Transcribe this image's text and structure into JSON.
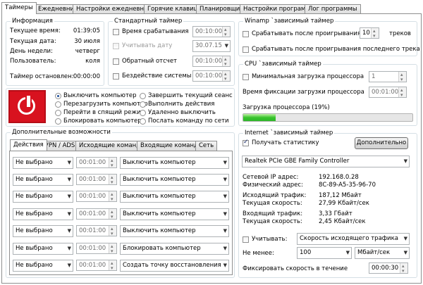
{
  "tabs": [
    {
      "label": "Таймеры",
      "active": true
    },
    {
      "label": "Ежедневник"
    },
    {
      "label": "Настройки ежедневника"
    },
    {
      "label": "Горячие клавиши"
    },
    {
      "label": "Планировщик"
    },
    {
      "label": "Настройки программы"
    },
    {
      "label": "Лог программы"
    }
  ],
  "info": {
    "title": "Информация",
    "rows": [
      {
        "label": "Текущее время:",
        "value": "01:39:05"
      },
      {
        "label": "Текущая дата:",
        "value": "30 июля"
      },
      {
        "label": "День недели:",
        "value": "четверг"
      },
      {
        "label": "Пользователь:",
        "value": "коля"
      }
    ],
    "timer_label": "Таймер остановлен:",
    "timer_value": "00:00:00"
  },
  "std_timer": {
    "title": "Стандартный таймер",
    "rows": [
      {
        "label": "Время срабатывания",
        "value": "00:10:00",
        "disabled": false
      },
      {
        "label": "Учитывать дату",
        "value": "30.07.15",
        "disabled": true
      },
      {
        "label": "Обратный отсчет",
        "value": "00:10:00",
        "disabled": false
      },
      {
        "label": "Бездействие системы",
        "value": "00:10:00",
        "disabled": false
      }
    ]
  },
  "actions": {
    "left": [
      {
        "label": "Выключить компьютер",
        "checked": true
      },
      {
        "label": "Перезагрузить компьютер"
      },
      {
        "label": "Перейти в спящий режим"
      },
      {
        "label": "Блокировать компьютер"
      }
    ],
    "right": [
      {
        "label": "Завершить текущий сеанс"
      },
      {
        "label": "Выполнить действия"
      },
      {
        "label": "Удаленно выключить"
      },
      {
        "label": "Послать команду по сети"
      }
    ]
  },
  "extra": {
    "title": "Дополнительные возможности",
    "subtabs": [
      {
        "label": "Действия",
        "active": true
      },
      {
        "label": "VPN / ADSL"
      },
      {
        "label": "Исходящие команды"
      },
      {
        "label": "Входящие команды"
      },
      {
        "label": "Сеть"
      }
    ],
    "rows": [
      {
        "cond": "Не выбрано",
        "time": "00:01:00",
        "action": "Выключить компьютер"
      },
      {
        "cond": "Не выбрано",
        "time": "00:01:00",
        "action": "Выключить компьютер"
      },
      {
        "cond": "Не выбрано",
        "time": "00:01:00",
        "action": "Выключить компьютер"
      },
      {
        "cond": "Не выбрано",
        "time": "00:01:00",
        "action": "Выключить компьютер"
      },
      {
        "cond": "Не выбрано",
        "time": "00:01:00",
        "action": "Выключить компьютер"
      },
      {
        "cond": "Не выбрано",
        "time": "00:01:00",
        "action": "Блокировать компьютер"
      },
      {
        "cond": "Не выбрано",
        "time": "00:01:00",
        "action": "Создать точку восстановления"
      }
    ]
  },
  "winamp": {
    "title": "Winamp `зависимый таймер",
    "after_play_label": "Срабатывать после проигрывания",
    "tracks_value": "10",
    "tracks_label": "треков",
    "after_last_label": "Срабатывать после проигрывания последнего трека"
  },
  "cpu": {
    "title": "CPU `зависимый таймер",
    "min_load_label": "Минимальная загрузка процессора",
    "min_load_value": "1",
    "fix_time_label": "Время фиксации загрузки процессора",
    "fix_time_value": "00:01:00",
    "load_label": "Загрузка процессора (19%)",
    "load_percent": 19
  },
  "internet": {
    "title": "Internet `зависимый таймер",
    "get_stats_label": "Получать статистику",
    "more_button": "Дополнительно",
    "adapter": "Realtek PCIe GBE Family Controller",
    "stats": [
      {
        "label": "Сетевой IP адрес:",
        "value": "192.168.0.28"
      },
      {
        "label": "Физический адрес:",
        "value": "8C-89-A5-35-96-70"
      },
      {
        "label": "Исходящий трафик:",
        "value": "187,12 Мбайт"
      },
      {
        "label": "Текущая скорость:",
        "value": "27,99 Кбайт/сек"
      },
      {
        "label": "Входящий трафик:",
        "value": "3,33 Гбайт"
      },
      {
        "label": "Текущая скорость:",
        "value": "2,45 Кбайт/сек"
      }
    ],
    "consider_label": "Учитывать:",
    "consider_value": "Скорость исходящего трафика",
    "not_less_label": "Не менее:",
    "not_less_value": "100",
    "unit_value": "Мбайт/сек",
    "fix_speed_label": "Фиксировать скорость в течение",
    "fix_speed_value": "00:00:30"
  }
}
